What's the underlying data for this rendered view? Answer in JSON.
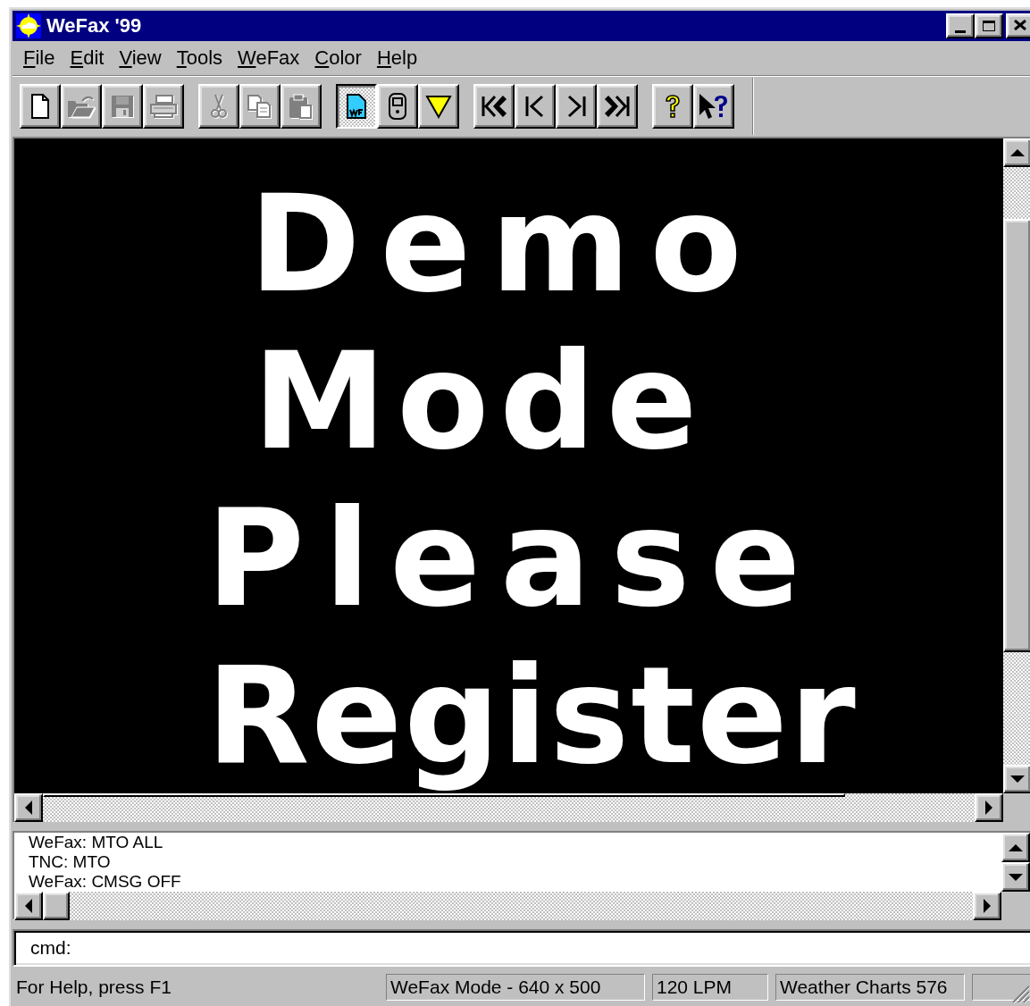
{
  "window": {
    "title": "WeFax '99"
  },
  "menu": [
    {
      "label": "File"
    },
    {
      "label": "Edit"
    },
    {
      "label": "View"
    },
    {
      "label": "Tools"
    },
    {
      "label": "WeFax"
    },
    {
      "label": "Color"
    },
    {
      "label": "Help"
    }
  ],
  "toolbar": [
    [
      {
        "kind": "new",
        "disabled": false,
        "pressed": false
      },
      {
        "kind": "open",
        "disabled": true,
        "pressed": false
      },
      {
        "kind": "save",
        "disabled": true,
        "pressed": false
      },
      {
        "kind": "print",
        "disabled": true,
        "pressed": false
      }
    ],
    [
      {
        "kind": "cut",
        "disabled": true,
        "pressed": false
      },
      {
        "kind": "copy",
        "disabled": true,
        "pressed": false
      },
      {
        "kind": "paste",
        "disabled": true,
        "pressed": false
      }
    ],
    [
      {
        "kind": "document",
        "disabled": false,
        "pressed": true
      },
      {
        "kind": "device",
        "disabled": false,
        "pressed": false
      },
      {
        "kind": "triangle",
        "disabled": false,
        "pressed": false
      }
    ],
    [
      {
        "kind": "first",
        "disabled": false,
        "pressed": false
      },
      {
        "kind": "prev",
        "disabled": false,
        "pressed": false
      },
      {
        "kind": "next",
        "disabled": false,
        "pressed": false
      },
      {
        "kind": "last",
        "disabled": false,
        "pressed": false
      }
    ],
    [
      {
        "kind": "help",
        "disabled": false,
        "pressed": false
      },
      {
        "kind": "context-help",
        "disabled": false,
        "pressed": false
      }
    ]
  ],
  "fax_view": {
    "lines": [
      "Demo",
      "Mode",
      "Please",
      "Register"
    ]
  },
  "log": {
    "lines": [
      "WeFax: MTO ALL",
      "TNC: MTO",
      "WeFax: CMSG OFF"
    ]
  },
  "command": {
    "prompt": "cmd:"
  },
  "status_bar": {
    "message": "For Help, press F1",
    "panes": [
      "WeFax Mode - 640 x 500",
      "120 LPM",
      "Weather Charts 576"
    ]
  }
}
